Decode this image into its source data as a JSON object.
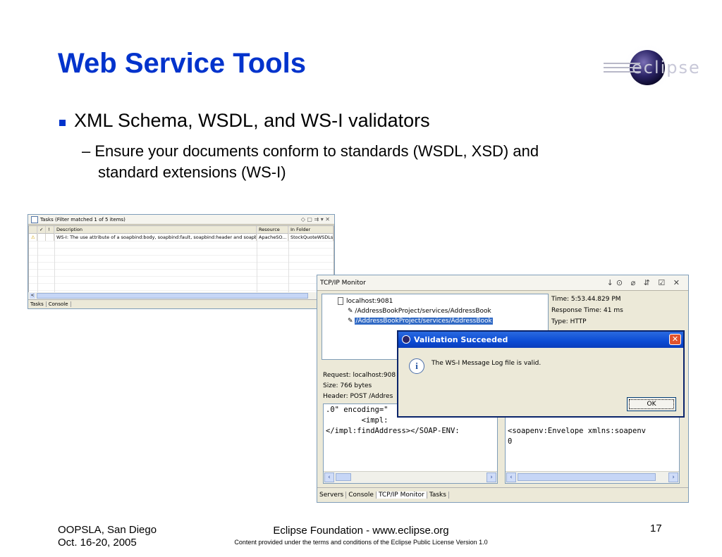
{
  "slide": {
    "title": "Web Service Tools",
    "bullet": "XML Schema, WSDL, and WS-I validators",
    "sub_line1": "– Ensure your documents conform to standards (WSDL, XSD) and",
    "sub_line2": "standard extensions (WS-I)"
  },
  "logo_text": "eclipse",
  "tasks_view": {
    "title": "Tasks (Filter matched 1 of 5 items)",
    "columns": [
      "✓",
      "!",
      "Description",
      "Resource",
      "In Folder"
    ],
    "rows": [
      {
        "description": "WS-I: The use attribute of a soapbind:body, soapbind:fault, soapbind:header and soapbi...",
        "resource": "ApacheSO...",
        "folder": "StockQuoteWSDLs"
      }
    ],
    "tabs": [
      "Tasks",
      "Console"
    ]
  },
  "tcp_monitor": {
    "title": "TCP/IP Monitor",
    "host": "localhost:9081",
    "requests": [
      "/AddressBookProject/services/AddressBook",
      "/AddressBookProject/services/AddressBook"
    ],
    "time": "Time: 5:53.44.829 PM",
    "response_time": "Response Time: 41 ms",
    "type": "Type: HTTP",
    "request_info": "Request: localhost:908",
    "size": "Size: 766 bytes",
    "header": "Header:  POST /Addres",
    "left_code": [
      ".0\" encoding=\"",
      "        <impl:",
      "</impl:findAddress></SOAP-ENV:"
    ],
    "right_code": [
      "<soapenv:Envelope xmlns:soapenv",
      "0"
    ],
    "tabs": [
      "Servers",
      "Console",
      "TCP/IP Monitor",
      "Tasks"
    ]
  },
  "dialog": {
    "title": "Validation Succeeded",
    "message": "The WS-I Message Log file is valid.",
    "ok": "OK"
  },
  "footer": {
    "left_line1": "OOPSLA, San Diego",
    "left_line2": "Oct. 16-20, 2005",
    "center_line1": "Eclipse Foundation - www.eclipse.org",
    "center_line2": "Content provided under the terms and conditions of the Eclipse Public License Version 1.0",
    "page": "17"
  },
  "colors": {
    "title": "#0033cc",
    "dialog_title": "#0b4bd4"
  }
}
